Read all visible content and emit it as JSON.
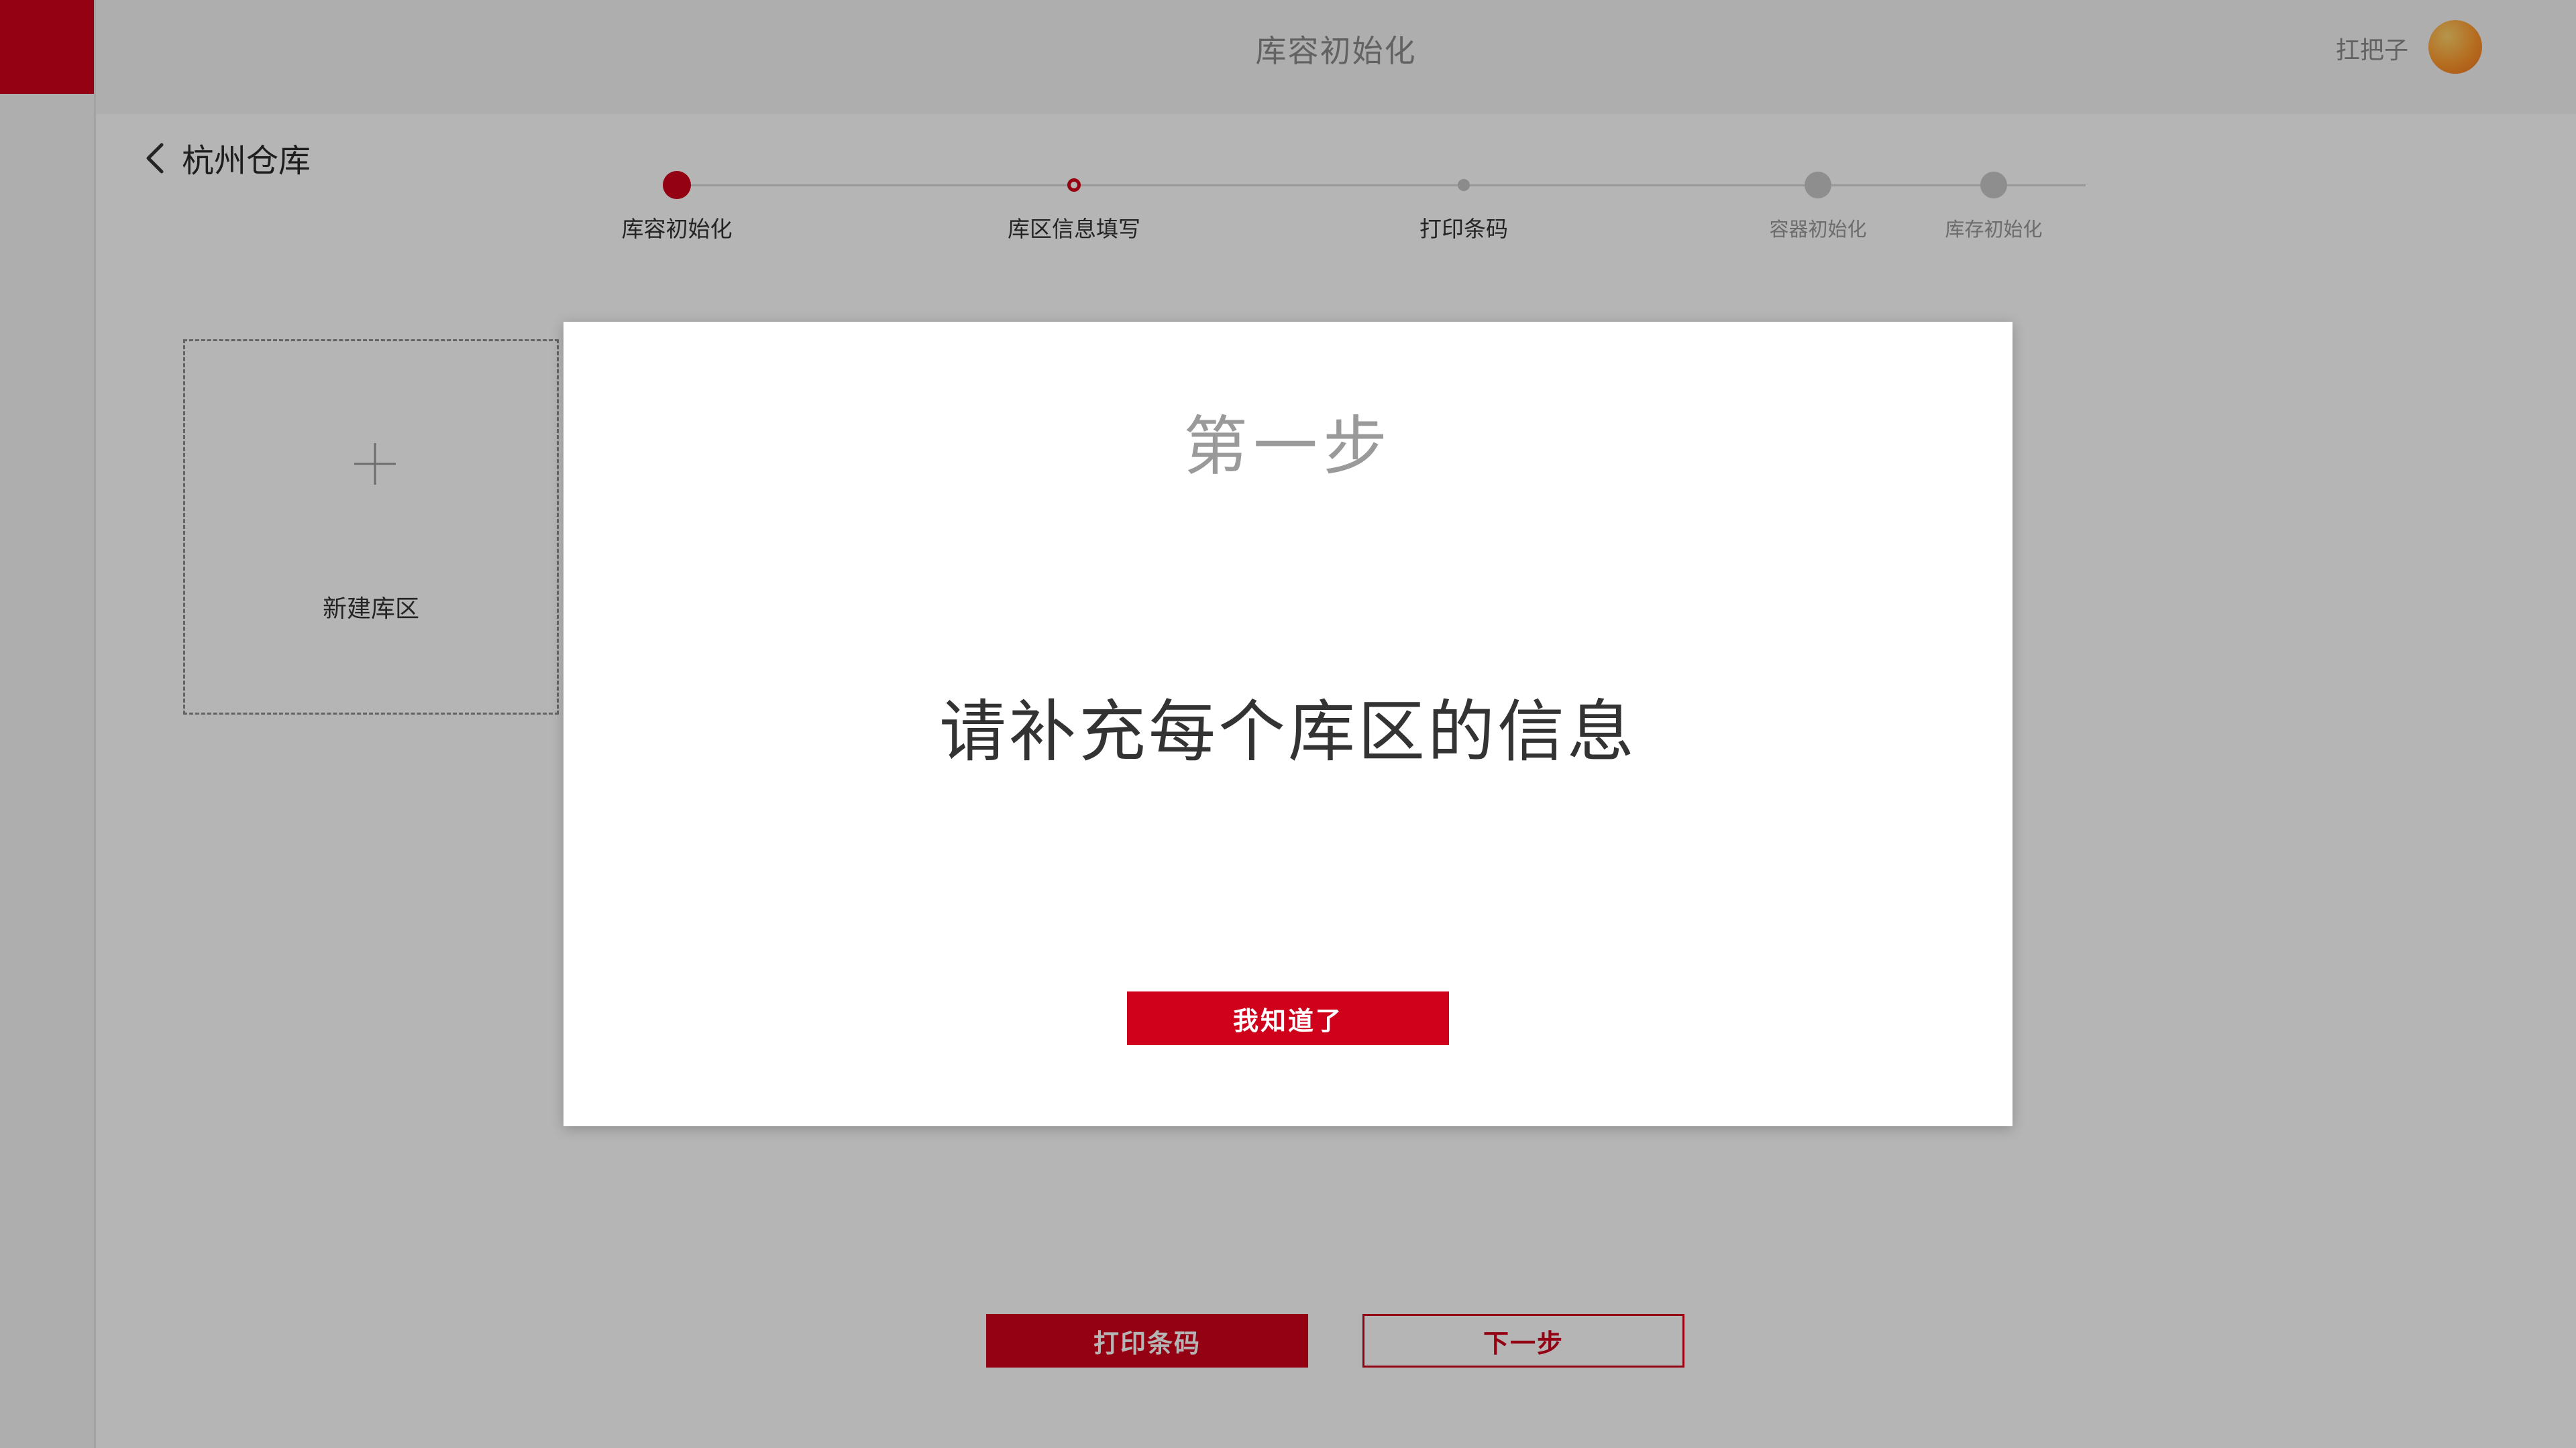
{
  "colors": {
    "brand_red": "#d0021b",
    "overlay": "rgba(0,0,0,0.29)",
    "avatar": "#ff9a2e"
  },
  "header": {
    "title": "库容初始化",
    "user_name": "扛把子"
  },
  "page": {
    "warehouse_name": "杭州仓库",
    "back_icon": "chevron-left-icon"
  },
  "stepper": {
    "steps": [
      {
        "label": "库容初始化",
        "state": "completed"
      },
      {
        "label": "库区信息填写",
        "state": "current"
      },
      {
        "label": "打印条码",
        "state": "pending"
      },
      {
        "label": "容器初始化",
        "state": "pending"
      },
      {
        "label": "库存初始化",
        "state": "pending"
      }
    ]
  },
  "new_area": {
    "label": "新建库区",
    "icon": "plus-icon"
  },
  "actions": {
    "print_label": "打印条码",
    "next_label": "下一步"
  },
  "modal": {
    "step_title": "第一步",
    "message": "请补充每个库区的信息",
    "confirm_label": "我知道了"
  }
}
